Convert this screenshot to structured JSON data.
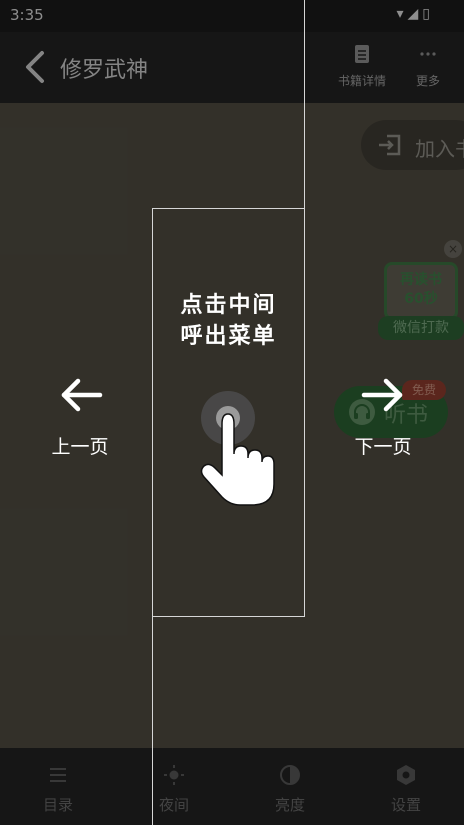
{
  "status_bar": {
    "time": "3:35",
    "icons": "▾◢▯"
  },
  "header": {
    "title": "修罗武神",
    "actions": [
      {
        "label": "书籍详情",
        "icon": "book-detail-icon"
      },
      {
        "label": "更多",
        "icon": "more-dots-icon"
      }
    ]
  },
  "add_shelf": {
    "label": "加入书"
  },
  "ad": {
    "close": "×",
    "line1": "再读书",
    "line2": "60秒",
    "button": "微信打款"
  },
  "listen": {
    "label": "听书",
    "badge": "免费"
  },
  "bottom_bar": {
    "items": [
      {
        "label": "目录",
        "icon": "catalog-icon"
      },
      {
        "label": "夜间",
        "icon": "night-mode-icon"
      },
      {
        "label": "亮度",
        "icon": "brightness-icon"
      },
      {
        "label": "设置",
        "icon": "settings-icon"
      }
    ]
  },
  "guide": {
    "center_line1": "点击中间",
    "center_line2": "呼出菜单",
    "prev_label": "上一页",
    "next_label": "下一页"
  },
  "colors": {
    "page_bg": "#4e4a3f",
    "bar_bg": "#222222",
    "accent_green": "#2a5e31",
    "badge_red": "#8a3b2c"
  }
}
